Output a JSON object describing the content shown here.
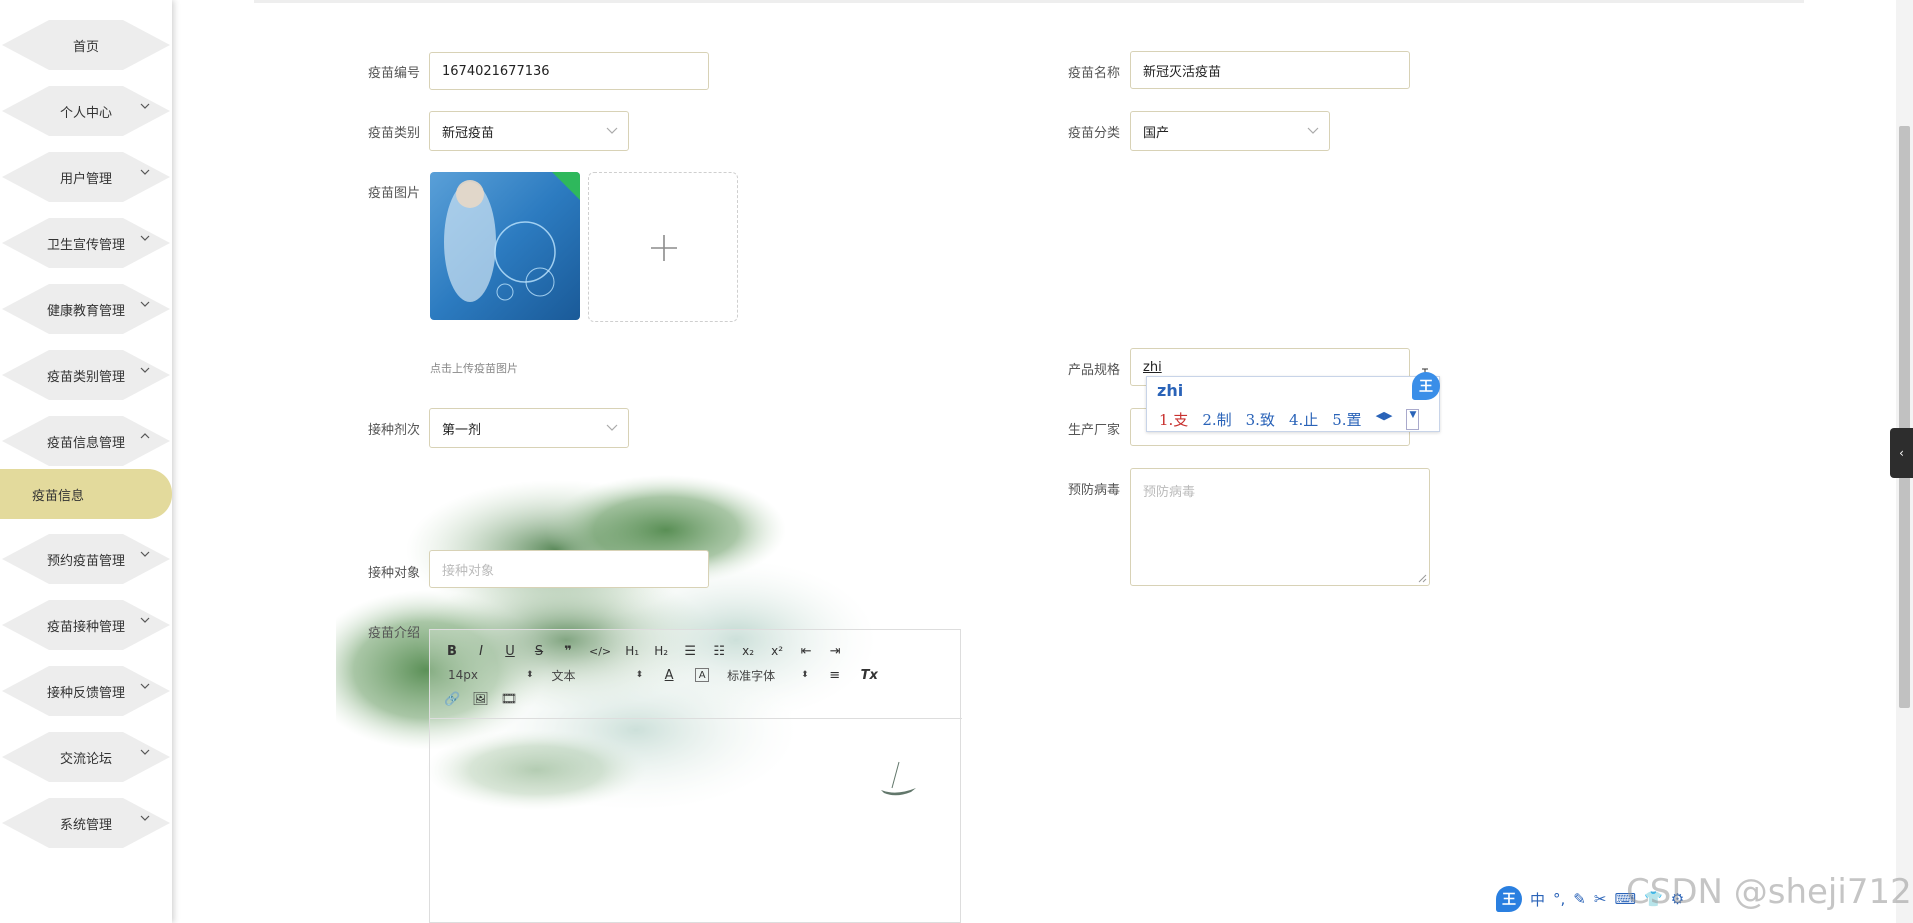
{
  "sidebar": {
    "items": [
      {
        "label": "首页",
        "expandable": false
      },
      {
        "label": "个人中心",
        "expandable": true
      },
      {
        "label": "用户管理",
        "expandable": true
      },
      {
        "label": "卫生宣传管理",
        "expandable": true
      },
      {
        "label": "健康教育管理",
        "expandable": true
      },
      {
        "label": "疫苗类别管理",
        "expandable": true
      },
      {
        "label": "疫苗信息管理",
        "expandable": true,
        "expanded": true
      },
      {
        "label": "预约疫苗管理",
        "expandable": true
      },
      {
        "label": "疫苗接种管理",
        "expandable": true
      },
      {
        "label": "接种反馈管理",
        "expandable": true
      },
      {
        "label": "交流论坛",
        "expandable": true
      },
      {
        "label": "系统管理",
        "expandable": true
      }
    ],
    "active_sub": "疫苗信息"
  },
  "form": {
    "vaccine_no": {
      "label": "疫苗编号",
      "value": "1674021677136"
    },
    "vaccine_name": {
      "label": "疫苗名称",
      "value": "新冠灭活疫苗"
    },
    "vaccine_type": {
      "label": "疫苗类别",
      "value": "新冠疫苗"
    },
    "vaccine_class": {
      "label": "疫苗分类",
      "value": "国产"
    },
    "vaccine_image": {
      "label": "疫苗图片",
      "hint": "点击上传疫苗图片"
    },
    "spec": {
      "label": "产品规格",
      "value": "zhi"
    },
    "manufacturer": {
      "label": "生产厂家"
    },
    "dose": {
      "label": "接种剂次",
      "value": "第一剂"
    },
    "prevent_virus": {
      "label": "预防病毒",
      "placeholder": "预防病毒"
    },
    "target": {
      "label": "接种对象",
      "placeholder": "接种对象"
    },
    "intro": {
      "label": "疫苗介绍"
    }
  },
  "editor": {
    "font_size": "14px",
    "text_style": "文本",
    "font_family": "标准字体"
  },
  "ime": {
    "pinyin": "zhi",
    "candidates": [
      "1.支",
      "2.制",
      "3.致",
      "4.止",
      "5.置"
    ],
    "badge": "王",
    "bar_items": [
      "中",
      "°,"
    ]
  },
  "watermark": "CSDN @sheji712",
  "colors": {
    "active_menu": "#e3da9c",
    "field_border": "#d8d2b6",
    "ime_blue": "#2a63b8"
  }
}
